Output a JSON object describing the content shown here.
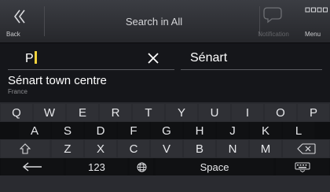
{
  "header": {
    "back_label": "Back",
    "title": "Search in All",
    "notification_label": "Notification",
    "menu_label": "Menu",
    "icons": {
      "back": "double-chevron-left-icon",
      "notification": "speech-bubble-icon",
      "menu": "grid-dots-icon"
    }
  },
  "search": {
    "query": "P",
    "location": "Sénart"
  },
  "result": {
    "name": "Sénart town centre",
    "country": "France"
  },
  "keyboard": {
    "row1": [
      "Q",
      "W",
      "E",
      "R",
      "T",
      "Y",
      "U",
      "I",
      "O",
      "P"
    ],
    "row2": [
      "A",
      "S",
      "D",
      "F",
      "G",
      "H",
      "J",
      "K",
      "L"
    ],
    "row3": [
      "Z",
      "X",
      "C",
      "V",
      "B",
      "N",
      "M"
    ],
    "row4": {
      "back": "left-arrow-icon",
      "numbers": "123",
      "globe": "globe-icon",
      "space": "Space",
      "hide": "keyboard-icon"
    },
    "shift": "shift-arrow-icon",
    "backspace": "backspace-icon",
    "colors": {
      "caret": "#f1d23c",
      "background": "#15161a"
    }
  }
}
